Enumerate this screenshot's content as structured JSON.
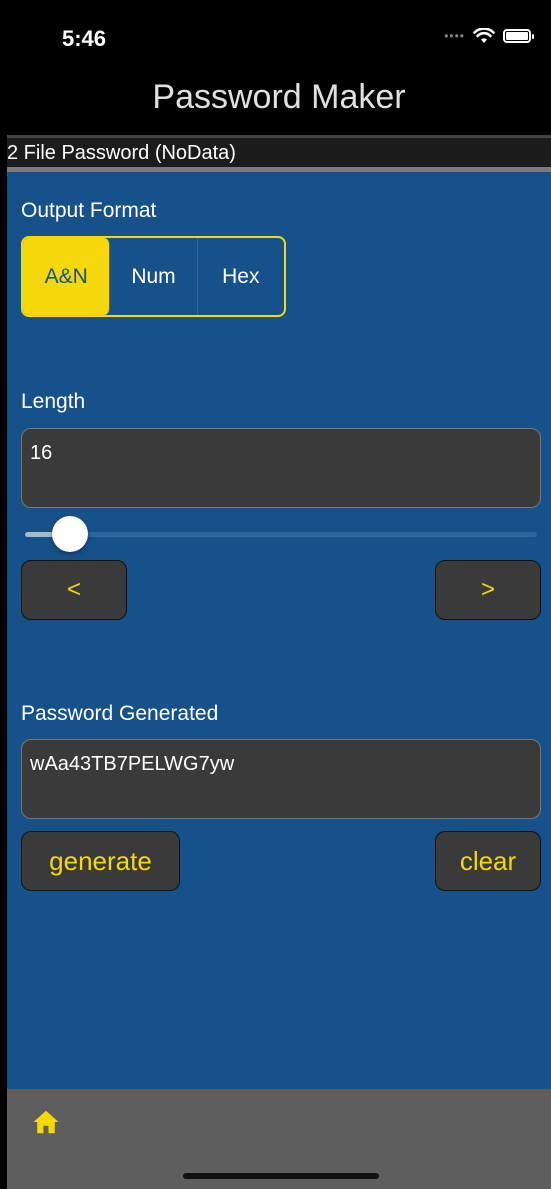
{
  "status_bar": {
    "time": "5:46"
  },
  "nav": {
    "title": "Password Maker"
  },
  "file_bar": {
    "label": "2 File Password (NoData)"
  },
  "output_format": {
    "label": "Output Format",
    "options": [
      "A&N",
      "Num",
      "Hex"
    ],
    "selected": "A&N"
  },
  "length": {
    "label": "Length",
    "value": "16",
    "slider_fraction": 0.08,
    "prev_label": "<",
    "next_label": ">"
  },
  "password": {
    "label": "Password Generated",
    "value": "wAa43TB7PELWG7yw",
    "generate_label": "generate",
    "clear_label": "clear"
  },
  "tab_bar": {
    "icon": "home-icon"
  },
  "colors": {
    "accent": "#f5d80a",
    "background": "#17518a",
    "field": "#3a3a3a",
    "tab_bar": "#5e5e5e"
  }
}
